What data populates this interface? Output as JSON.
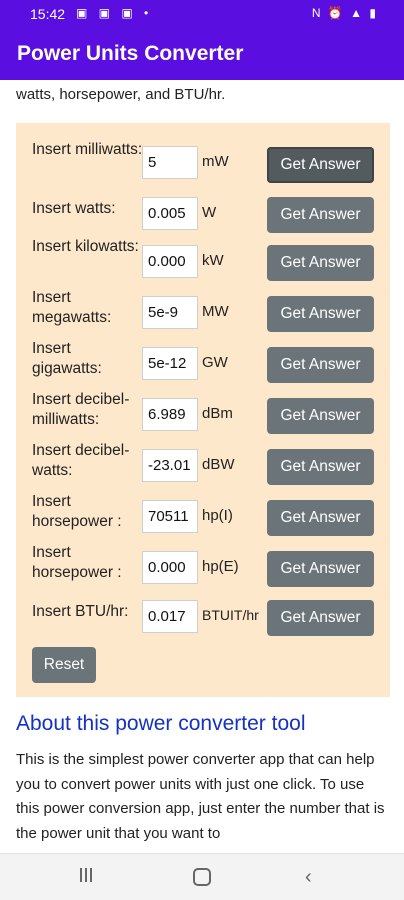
{
  "status_bar": {
    "time": "15:42",
    "left_icons": [
      "image-icon",
      "image-icon",
      "message-icon",
      "dot-icon"
    ],
    "right_icons": "N ⏰ 📶 ᵛᵒ ▮"
  },
  "app_bar": {
    "title": "Power Units Converter"
  },
  "intro_text": "watts, horsepower, and BTU/hr.",
  "converter": {
    "rows": [
      {
        "label": "Insert milliwatts:",
        "value": "5",
        "unit": "mW",
        "button": "Get Answer"
      },
      {
        "label": "Insert watts:",
        "value": "0.005",
        "unit": "W",
        "button": "Get Answer"
      },
      {
        "label": "Insert kilowatts:",
        "value": "0.000",
        "unit": "kW",
        "button": "Get Answer"
      },
      {
        "label": "Insert megawatts:",
        "value": "5e-9",
        "unit": "MW",
        "button": "Get Answer"
      },
      {
        "label": "Insert gigawatts:",
        "value": "5e-12",
        "unit": "GW",
        "button": "Get Answer"
      },
      {
        "label": "Insert decibel-milliwatts:",
        "value": "6.989",
        "unit": "dBm",
        "button": "Get Answer"
      },
      {
        "label": "Insert decibel-watts:",
        "value": "-23.01",
        "unit": "dBW",
        "button": "Get Answer"
      },
      {
        "label": "Insert horsepower :",
        "value": "70511",
        "unit": "hp(I)",
        "button": "Get Answer"
      },
      {
        "label": "Insert horsepower :",
        "value": "0.000",
        "unit": "hp(E)",
        "button": "Get Answer"
      },
      {
        "label": "Insert BTU/hr:",
        "value": "0.017",
        "unit": "BTUIT/hr",
        "button": "Get Answer"
      }
    ],
    "reset_label": "Reset"
  },
  "about": {
    "title": "About this power converter tool",
    "text": "This is the simplest power converter app that can help you to convert power units with just one click. To use this power conversion app, just enter the number that is the power unit that you want to"
  },
  "nav_bar": {
    "recent": "recent-apps-icon",
    "home": "home-icon",
    "back": "back-icon"
  }
}
